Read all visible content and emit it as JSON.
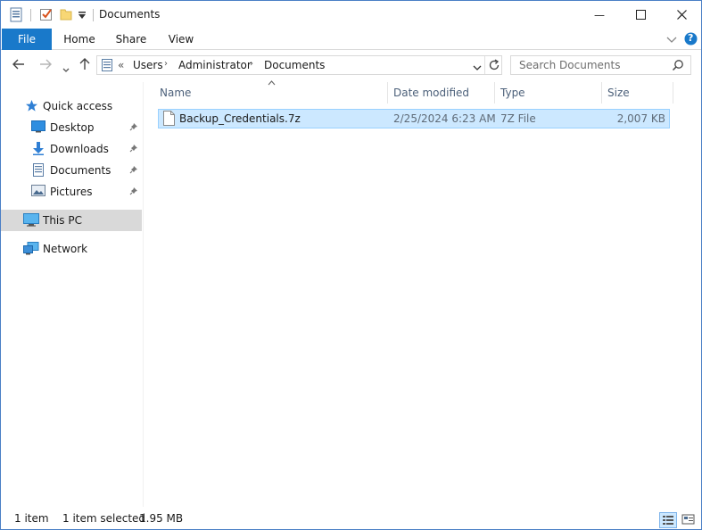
{
  "window": {
    "title": "Documents",
    "minimize_glyph": "—",
    "maximize_glyph": "☐",
    "close_glyph": "✕"
  },
  "ribbon": {
    "tabs": [
      "File",
      "Home",
      "Share",
      "View"
    ],
    "help_glyph": "?"
  },
  "address": {
    "overflow": "«",
    "crumbs": [
      "Users",
      "Administrator",
      "Documents"
    ]
  },
  "search": {
    "placeholder": "Search Documents"
  },
  "sidebar": {
    "items": [
      {
        "label": "Quick access",
        "icon": "star-icon"
      },
      {
        "label": "Desktop",
        "icon": "desktop-icon"
      },
      {
        "label": "Downloads",
        "icon": "downloads-icon"
      },
      {
        "label": "Documents",
        "icon": "documents-icon"
      },
      {
        "label": "Pictures",
        "icon": "pictures-icon"
      },
      {
        "label": "This PC",
        "icon": "computer-icon"
      },
      {
        "label": "Network",
        "icon": "network-icon"
      }
    ]
  },
  "columns": [
    "Name",
    "Date modified",
    "Type",
    "Size"
  ],
  "files": [
    {
      "name": "Backup_Credentials.7z",
      "date": "2/25/2024 6:23 AM",
      "type": "7Z File",
      "size": "2,007 KB"
    }
  ],
  "status": {
    "count": "1 item",
    "selected": "1 item selected",
    "size": "1.95 MB"
  },
  "colors": {
    "accent": "#1979ca",
    "selection": "#cce8ff",
    "selection_border": "#99d1ff"
  }
}
